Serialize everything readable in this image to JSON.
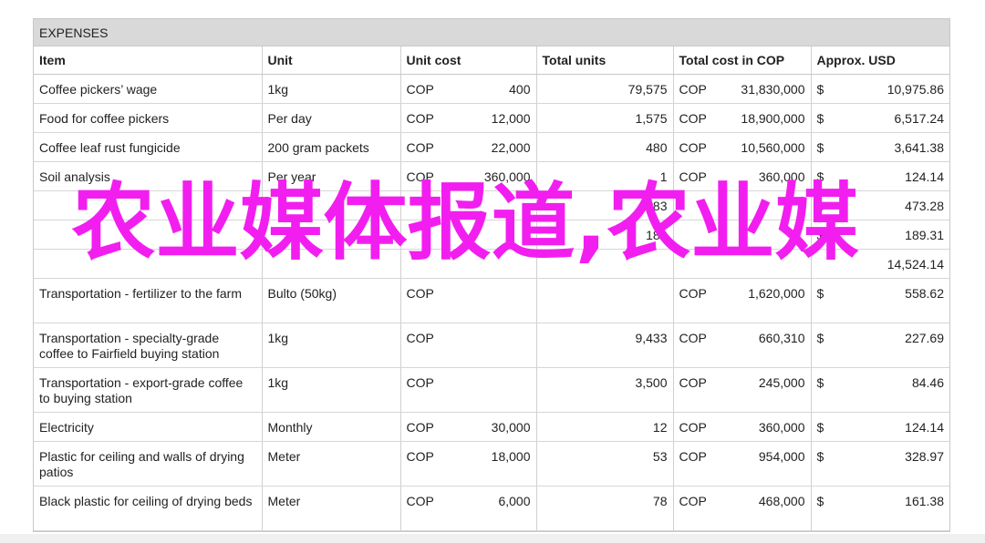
{
  "sheet": {
    "title": "EXPENSES",
    "headers": [
      "Item",
      "Unit",
      "Unit cost",
      "Total units",
      "Total cost in COP",
      "Approx. USD"
    ],
    "rows": [
      {
        "item": "Coffee pickers’ wage",
        "unit": "1kg",
        "cur": "COP",
        "unit_cost": "400",
        "total_units": "79,575",
        "tcur": "COP",
        "total_cost": "31,830,000",
        "usd_sym": "$",
        "usd": "10,975.86"
      },
      {
        "item": "Food for coffee pickers",
        "unit": "Per day",
        "cur": "COP",
        "unit_cost": "12,000",
        "total_units": "1,575",
        "tcur": "COP",
        "total_cost": "18,900,000",
        "usd_sym": "$",
        "usd": "6,517.24"
      },
      {
        "item": "Coffee leaf rust fungicide",
        "unit": "200 gram packets",
        "cur": "COP",
        "unit_cost": "22,000",
        "total_units": "480",
        "tcur": "COP",
        "total_cost": "10,560,000",
        "usd_sym": "$",
        "usd": "3,641.38"
      },
      {
        "item": "Soil analysis",
        "unit": "Per year",
        "cur": "COP",
        "unit_cost": "360,000",
        "total_units": "1",
        "tcur": "COP",
        "total_cost": "360,000",
        "usd_sym": "$",
        "usd": "124.14"
      },
      {
        "item": "",
        "unit": "",
        "cur": "",
        "unit_cost": "",
        "total_units": "183",
        "tcur": "",
        "total_cost": "",
        "usd_sym": "$",
        "usd": "473.28"
      },
      {
        "item": "",
        "unit": "",
        "cur": "",
        "unit_cost": "",
        "total_units": "183",
        "tcur": "",
        "total_cost": "",
        "usd_sym": "$",
        "usd": "189.31"
      },
      {
        "item": "",
        "unit": "",
        "cur": "",
        "unit_cost": "",
        "total_units": "",
        "tcur": "",
        "total_cost": "",
        "usd_sym": "",
        "usd": "14,524.14"
      },
      {
        "item": "Transportation - fertilizer to the farm",
        "unit": "Bulto (50kg)",
        "cur": "COP",
        "unit_cost": "",
        "total_units": "",
        "tcur": "COP",
        "total_cost": "1,620,000",
        "usd_sym": "$",
        "usd": "558.62"
      },
      {
        "item": "Transportation - specialty-grade coffee to Fairfield buying station",
        "unit": "1kg",
        "cur": "COP",
        "unit_cost": "",
        "total_units": "9,433",
        "tcur": "COP",
        "total_cost": "660,310",
        "usd_sym": "$",
        "usd": "227.69"
      },
      {
        "item": "Transportation - export-grade coffee to buying station",
        "unit": "1kg",
        "cur": "COP",
        "unit_cost": "",
        "total_units": "3,500",
        "tcur": "COP",
        "total_cost": "245,000",
        "usd_sym": "$",
        "usd": "84.46"
      },
      {
        "item": "Electricity",
        "unit": "Monthly",
        "cur": "COP",
        "unit_cost": "30,000",
        "total_units": "12",
        "tcur": "COP",
        "total_cost": "360,000",
        "usd_sym": "$",
        "usd": "124.14"
      },
      {
        "item": "Plastic for ceiling and walls of drying patios",
        "unit": "Meter",
        "cur": "COP",
        "unit_cost": "18,000",
        "total_units": "53",
        "tcur": "COP",
        "total_cost": "954,000",
        "usd_sym": "$",
        "usd": "328.97"
      },
      {
        "item": "Black plastic for ceiling of drying beds",
        "unit": "Meter",
        "cur": "COP",
        "unit_cost": "6,000",
        "total_units": "78",
        "tcur": "COP",
        "total_cost": "468,000",
        "usd_sym": "$",
        "usd": "161.38"
      }
    ]
  },
  "overlay": {
    "text": "农业媒体报道,农业媒",
    "color": "#f21ef0"
  }
}
